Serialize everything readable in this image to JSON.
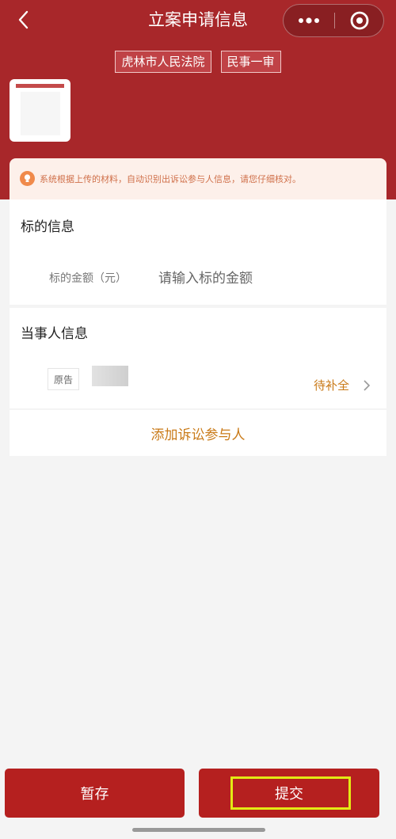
{
  "header": {
    "title": "立案申请信息",
    "tags": [
      "虎林市人民法院",
      "民事一审"
    ],
    "accent_color": "#a8272a",
    "icons": {
      "back": "chevron-left-icon",
      "more": "more-dots-icon",
      "close": "target-icon"
    }
  },
  "notice": {
    "text": "系统根据上传的材料，自动识别出诉讼参与人信息，请您仔细核对。",
    "icon": "lightbulb-icon"
  },
  "subject_section": {
    "title": "标的信息",
    "amount_label": "标的金额（元）",
    "amount_placeholder": "请输入标的金额"
  },
  "party_section": {
    "title": "当事人信息",
    "party_role": "原告",
    "party_status": "待补全"
  },
  "add_party_label": "添加诉讼参与人",
  "footer": {
    "save_label": "暂存",
    "submit_label": "提交",
    "button_color": "#b5201f",
    "highlight_color": "#e3ea14"
  }
}
